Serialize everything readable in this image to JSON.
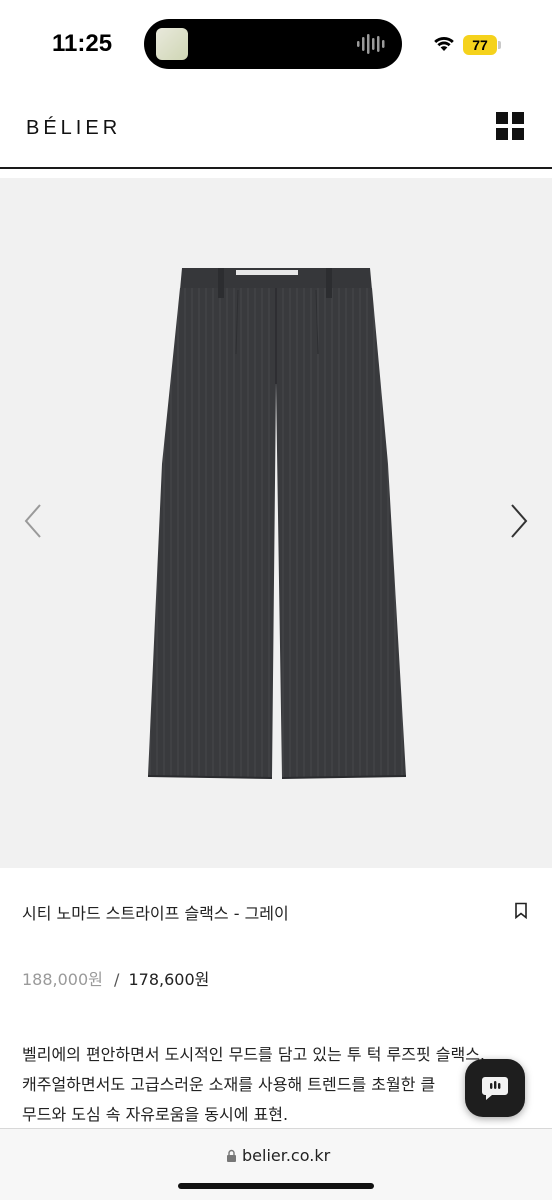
{
  "status_bar": {
    "time": "11:25",
    "battery": "77"
  },
  "header": {
    "logo": "BÉLIER",
    "menu_icon": "grid-menu-icon"
  },
  "product": {
    "image_alt_icon": "pants-image",
    "name": "시티 노마드 스트라이프 슬랙스 - 그레이",
    "price_original": "188,000원",
    "price_separator": "/",
    "price_sale": "178,600원",
    "description": [
      "벨리에의 편안하면서 도시적인 무드를 담고 있는 투 턱 루즈핏 슬랙스.",
      "캐주얼하면서도 고급스러운 소재를 사용해 트렌드를 초월한 클",
      "무드와 도심 속 자유로움을 동시에 표현."
    ]
  },
  "browser": {
    "url": "belier.co.kr"
  },
  "colors": {
    "background": "#ffffff",
    "hero_bg": "#f1f1f1",
    "battery": "#f5d21c",
    "pants": "#3a3b3e"
  }
}
